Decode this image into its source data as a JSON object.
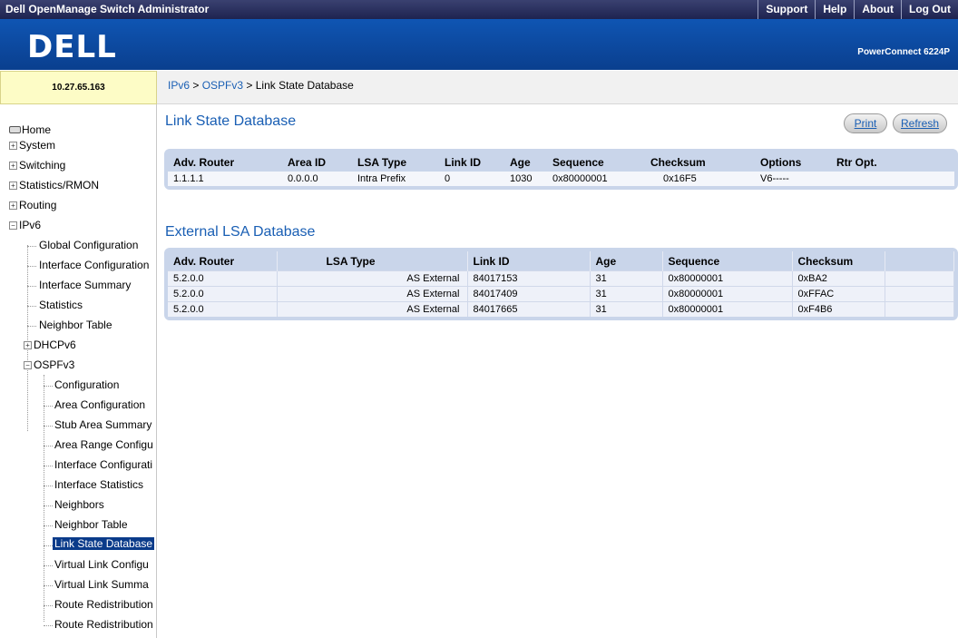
{
  "topbar": {
    "title": "Dell OpenManage Switch Administrator",
    "links": [
      "Support",
      "Help",
      "About",
      "Log Out"
    ]
  },
  "banner": {
    "logo": "DELL",
    "model": "PowerConnect 6224P"
  },
  "ip_address": "10.27.65.163",
  "breadcrumb": {
    "part1": "IPv6",
    "sep1": " > ",
    "part2": "OSPFv3",
    "sep2": " > ",
    "current": "Link State Database"
  },
  "sidebar": {
    "home": "Home",
    "system": "System",
    "switching": "Switching",
    "statistics_rmon": "Statistics/RMON",
    "routing": "Routing",
    "ipv6": "IPv6",
    "ipv6_items": [
      "Global Configuration",
      "Interface Configuration",
      "Interface Summary",
      "Statistics",
      "Neighbor Table"
    ],
    "dhcpv6": "DHCPv6",
    "ospfv3": "OSPFv3",
    "ospfv3_items": [
      "Configuration",
      "Area Configuration",
      "Stub Area Summary",
      "Area Range Configu",
      "Interface Configurati",
      "Interface Statistics",
      "Neighbors",
      "Neighbor Table",
      "Link State Database",
      "Virtual Link Configu",
      "Virtual Link Summa",
      "Route Redistribution",
      "Route Redistribution"
    ]
  },
  "lsdb": {
    "title": "Link State Database",
    "print_label": "Print",
    "refresh_label": "Refresh",
    "columns": [
      "Adv. Router",
      "Area ID",
      "LSA Type",
      "Link ID",
      "Age",
      "Sequence",
      "Checksum",
      "Options",
      "Rtr Opt."
    ],
    "rows": [
      [
        "1.1.1.1",
        "0.0.0.0",
        "Intra Prefix",
        "0",
        "1030",
        "0x80000001",
        "0x16F5",
        "V6-----",
        ""
      ]
    ]
  },
  "external_lsdb": {
    "title": "External LSA Database",
    "columns": [
      "Adv. Router",
      "LSA Type",
      "Link ID",
      "Age",
      "Sequence",
      "Checksum",
      ""
    ],
    "rows": [
      [
        "5.2.0.0",
        "AS External",
        "84017153",
        "31",
        "0x80000001",
        "0xBA2",
        ""
      ],
      [
        "5.2.0.0",
        "AS External",
        "84017409",
        "31",
        "0x80000001",
        "0xFFAC",
        ""
      ],
      [
        "5.2.0.0",
        "AS External",
        "84017665",
        "31",
        "0x80000001",
        "0xF4B6",
        ""
      ]
    ]
  },
  "colors": {
    "banner": "#0f55b3",
    "link": "#1a5fb4",
    "table_frame": "#c9d5ea",
    "active_nav": "#0a3b8a"
  }
}
